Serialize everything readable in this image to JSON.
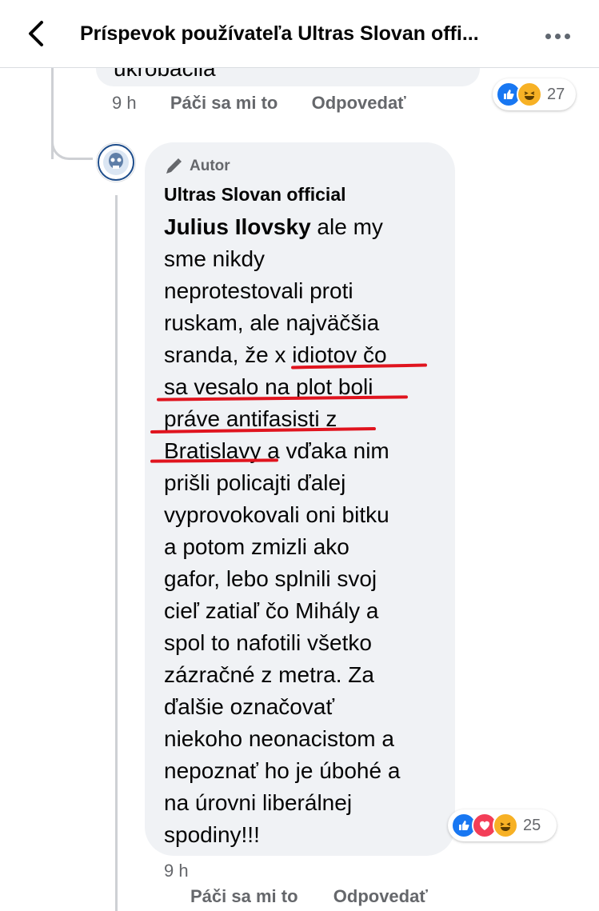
{
  "header": {
    "title": "Príspevok používateľa Ultras Slovan offi...",
    "back_icon": "chevron-left-icon",
    "more_icon": "more-horizontal-icon"
  },
  "previous_comment": {
    "partial_text": "ukrobáčila",
    "time": "9 h",
    "like_label": "Páči sa mi to",
    "reply_label": "Odpovedať",
    "reaction_count": "27",
    "reactions": [
      "like-icon",
      "haha-icon"
    ]
  },
  "reply_comment": {
    "author_badge": "Autor",
    "author_badge_icon": "pencil-icon",
    "commenter_name": "Ultras Slovan official",
    "mention": "Julius Ilovsky",
    "lines": [
      " ale my",
      "sme nikdy",
      "neprotestovali proti",
      "ruskam, ale najväčšia",
      "sranda, že x idiotov čo",
      "sa vesalo na plot boli",
      "práve antifasisti z",
      "Bratislavy a vďaka nim",
      "prišli policajti ďalej",
      "vyprovokovali oni bitku",
      "a potom zmizli ako",
      "gafor, lebo splnili svoj",
      "cieľ zatiaľ čo Mihály a",
      "spol to nafotili všetko",
      "zázračné z metra. Za",
      "ďalšie označovať",
      "niekoho neonacistom a",
      "nepoznať ho je úbohé a",
      "na úrovni liberálnej",
      "spodiny!!!"
    ],
    "time": "9 h",
    "like_label": "Páči sa mi to",
    "reply_label": "Odpovedať",
    "reaction_count": "25",
    "reactions": [
      "like-icon",
      "love-icon",
      "haha-icon"
    ]
  },
  "colors": {
    "bubble": "#f0f2f5",
    "meta_text": "#65676b",
    "annotation_red": "#e0141e",
    "like_blue": "#1877f2"
  }
}
